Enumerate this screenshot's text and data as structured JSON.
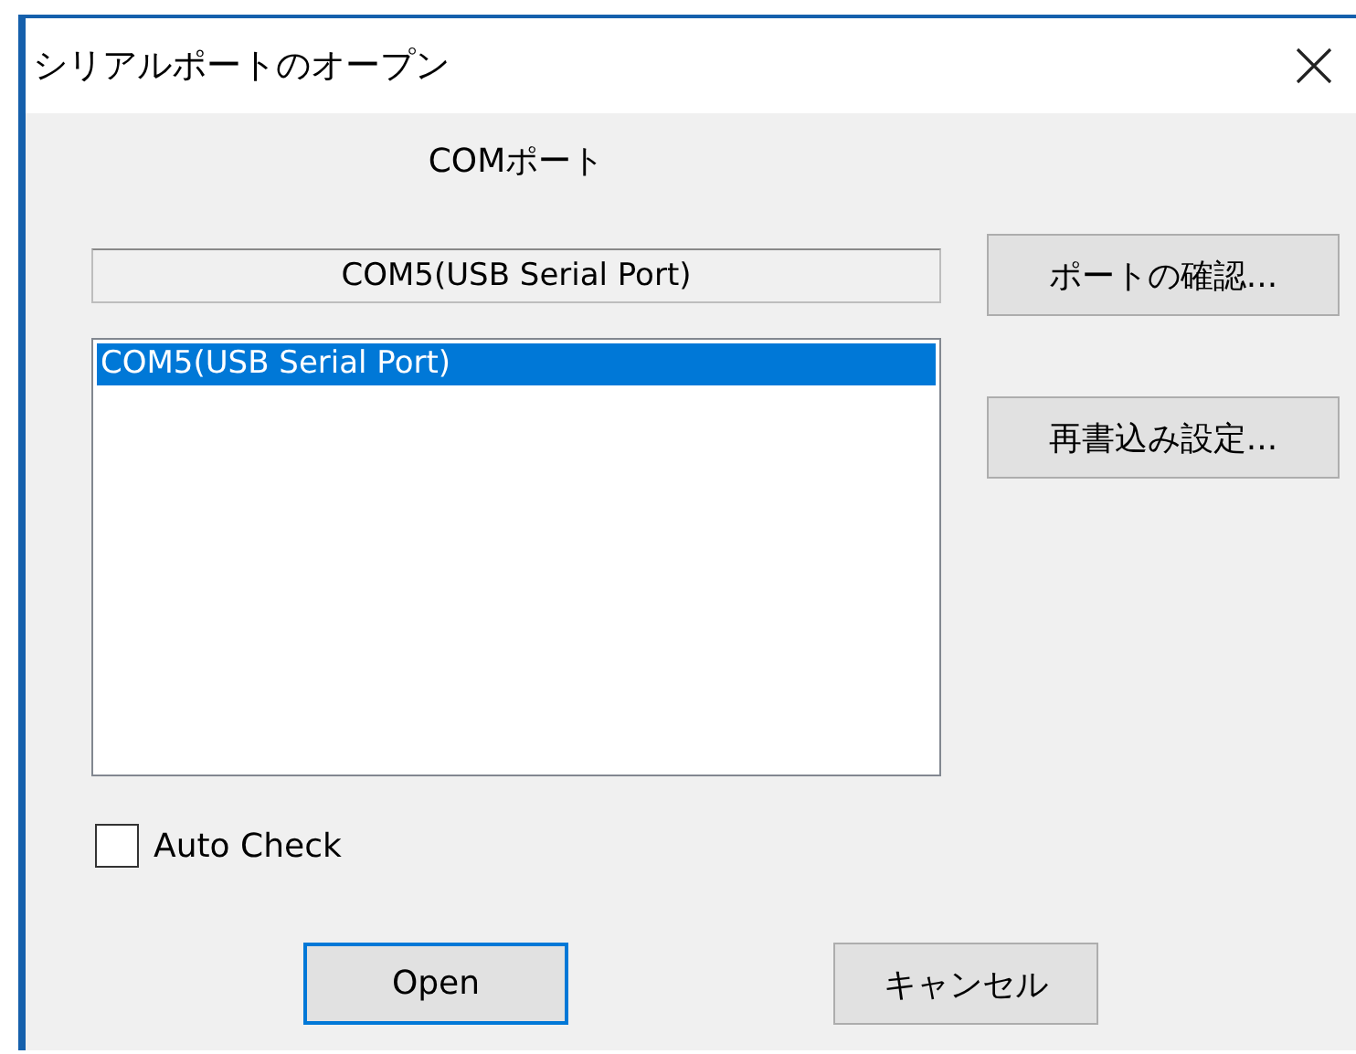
{
  "window": {
    "title": "シリアルポートのオープン"
  },
  "port_label": "COMポート",
  "current_port": {
    "value": "COM5(USB Serial Port)"
  },
  "ports": [
    {
      "label": "COM5(USB Serial Port)",
      "selected": true
    }
  ],
  "side_buttons": [
    "ポートの確認...",
    "再書込み設定..."
  ],
  "auto_check": {
    "label": "Auto Check",
    "checked": false
  },
  "buttons": [
    {
      "label": "Open",
      "default": true
    },
    {
      "label": "キャンセル",
      "default": false
    }
  ]
}
